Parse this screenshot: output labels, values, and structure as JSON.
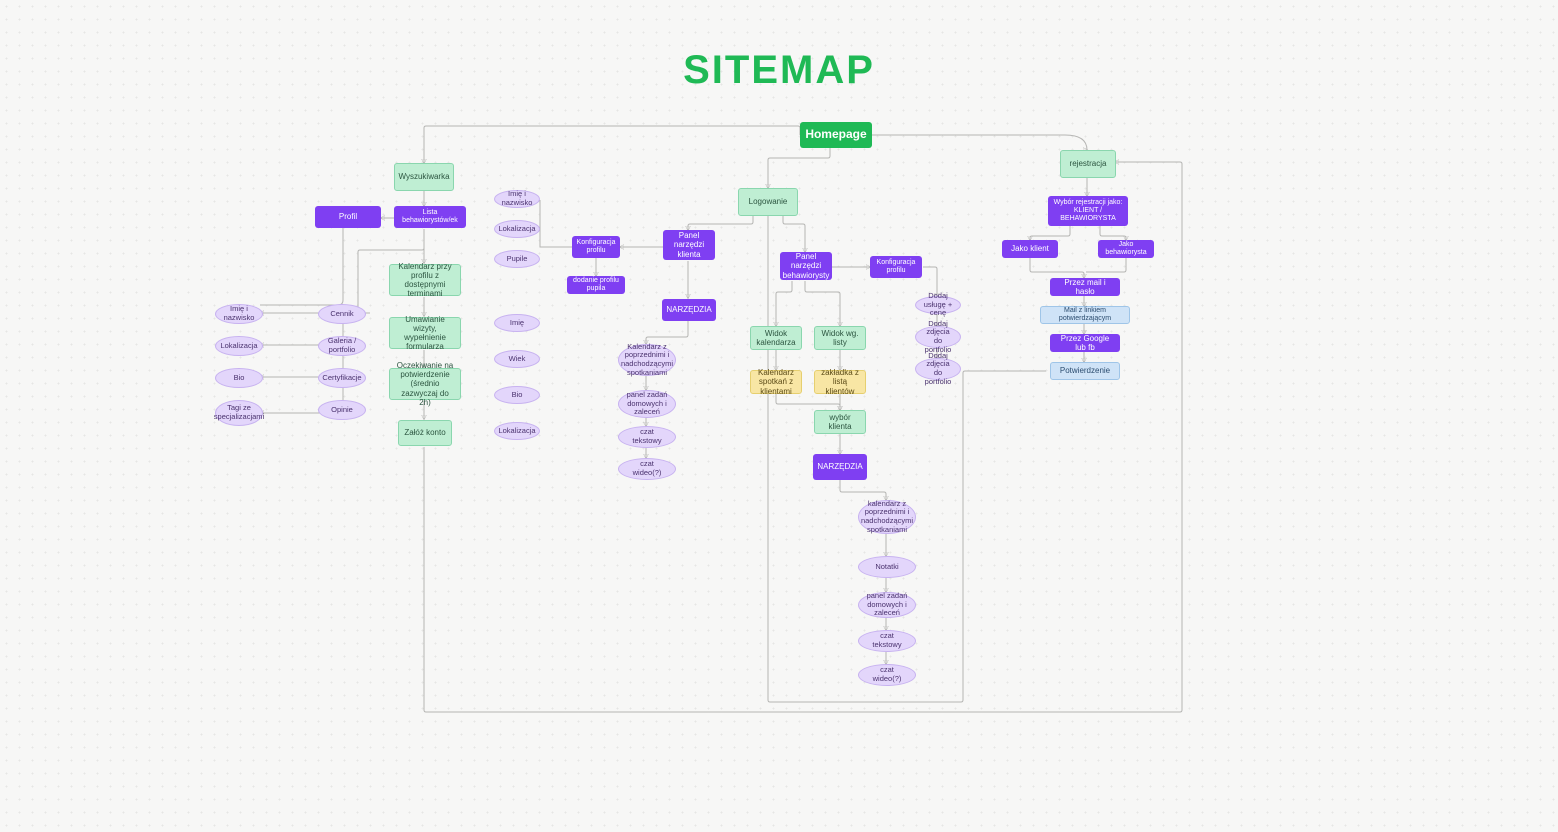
{
  "title": "SITEMAP",
  "root": "Homepage",
  "col_search": {
    "wyszukiwarka": "Wyszukiwarka",
    "profil": "Profil",
    "lista": "Lista behawiorystów/ek",
    "kalendarz": "Kalendarz przy profilu z dostępnymi terminami",
    "umawianie": "Umawianie wizyty, wypełnienie formularza",
    "oczekiwanie": "Oczekiwanie na potwierdzenie (średnio zazwyczaj do 2h)",
    "zaloz": "Załóż konto",
    "ovals_left": [
      "Imię i nazwisko",
      "Lokalizacja",
      "Bio",
      "Tagi ze specjalizacjami"
    ],
    "ovals_mid": [
      "Cennik",
      "Galeria / portfolio",
      "Certyfikacje",
      "Opinie"
    ]
  },
  "col_konfig_klient": {
    "konfiguracja": "Konfiguracja profilu",
    "dodanie": "dodanie profilu pupila",
    "ovals_top": [
      "Imię i nazwisko",
      "Lokalizacja",
      "Pupile"
    ],
    "ovals_bot": [
      "Imię",
      "Wiek",
      "Bio",
      "Lokalizacja"
    ]
  },
  "col_narz_klient": {
    "logowanie": "Logowanie",
    "panel": "Panel narzędzi klienta",
    "narzedzia": "NARZĘDZIA",
    "ovals": [
      "Kalendarz z poprzednimi i nadchodzącymi spotkaniami",
      "panel zadań domowych i zaleceń",
      "czat tekstowy",
      "czat wideo(?)"
    ]
  },
  "col_behaw": {
    "panel": "Panel narzędzi behawiorysty",
    "konfiguracja": "Konfiguracja profilu",
    "ovals_konf": [
      "Dodaj usługę + cenę",
      "Dodaj zdjęcia do portfolio",
      "Dodaj zdjęcia do portfolio"
    ],
    "widok_kal": "Widok kalendarza",
    "widok_listy": "Widok wg. listy",
    "kal_spotkan": "Kalendarz spotkań z klientami",
    "zakladka": "zakładka z listą klientów",
    "wybor": "wybór klienta",
    "narzedzia": "NARZĘDZIA",
    "ovals": [
      "kalendarz z poprzednimi i nadchodzącymi spotkaniami",
      "Notatki",
      "panel zadań domowych i zaleceń",
      "czat tekstowy",
      "czat wideo(?)"
    ]
  },
  "col_rej": {
    "rejestracja": "rejestracja",
    "wybor": "Wybór rejestracji jako: KLIENT / BEHAWIORYSTA",
    "jako_klient": "Jako klient",
    "jako_beh": "Jako behawiorysta",
    "przez_mail": "Przez mail i hasło",
    "mail_link": "Mail z linkiem potwierdzającym",
    "przez_google": "Przez Google lub fb",
    "potw": "Potwierdzenie"
  }
}
